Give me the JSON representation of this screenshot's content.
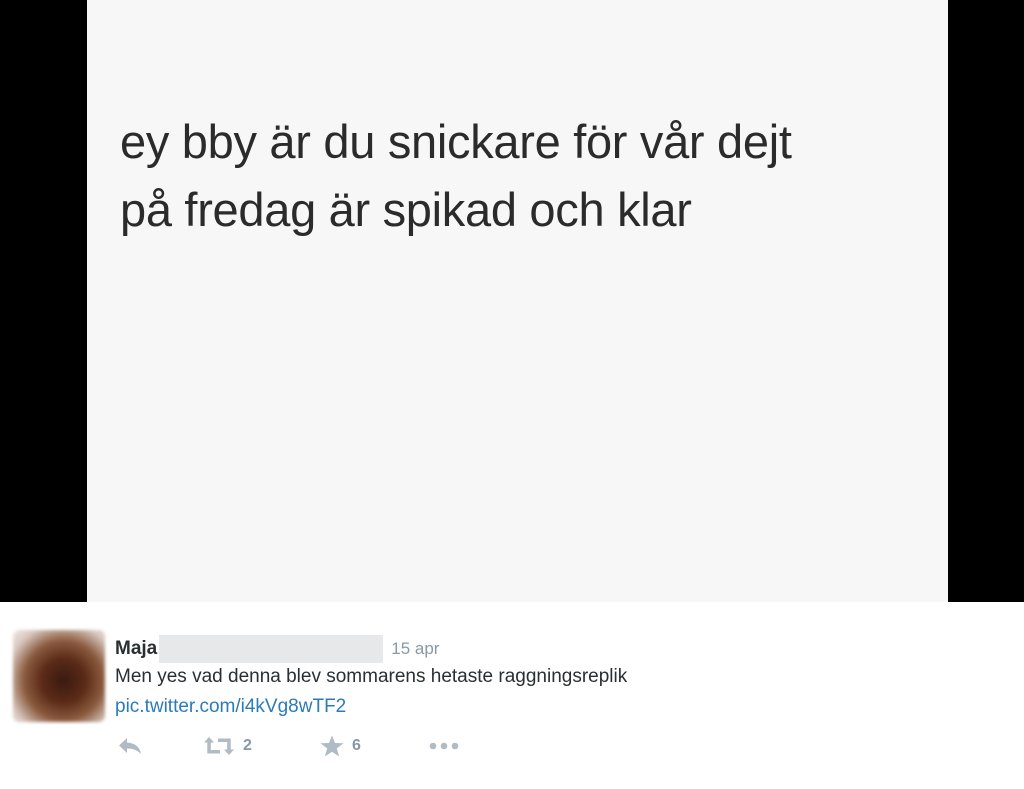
{
  "media": {
    "lines": [
      "ey bby är du snickare för vår dejt",
      "på fredag är spikad och klar"
    ]
  },
  "tweet": {
    "author": "Maja",
    "timestamp": "15 apr",
    "text": "Men yes vad denna blev sommarens hetaste raggningsreplik",
    "link": "pic.twitter.com/i4kVg8wTF2"
  },
  "actions": {
    "reply_icon": "reply-icon",
    "retweet_icon": "retweet-icon",
    "retweet_count": "2",
    "favorite_icon": "star-icon",
    "favorite_count": "6",
    "more_icon": "more-dots-icon"
  },
  "colors": {
    "link": "#2b7bb9",
    "muted": "#8899a6",
    "icon": "#b1bbc3",
    "text": "#292f33"
  }
}
